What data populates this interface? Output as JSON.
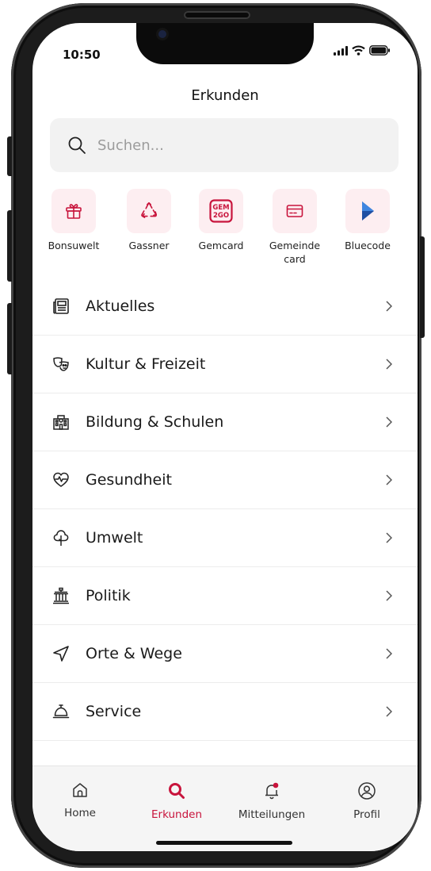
{
  "status_bar": {
    "time": "10:50"
  },
  "header": {
    "title": "Erkunden"
  },
  "search": {
    "placeholder": "Suchen..."
  },
  "quick_actions": [
    {
      "label": "Bonsuwelt",
      "icon": "gift-icon"
    },
    {
      "label": "Gassner",
      "icon": "recycle-icon"
    },
    {
      "label": "Gemcard",
      "icon": "gem2go-logo-icon",
      "logo_text": "GEM 2GO"
    },
    {
      "label": "Gemeinde card",
      "icon": "credit-card-icon"
    },
    {
      "label": "Bluecode",
      "icon": "bluecode-logo-icon"
    }
  ],
  "menu": [
    {
      "label": "Aktuelles",
      "icon": "newspaper-icon"
    },
    {
      "label": "Kultur & Freizeit",
      "icon": "theater-masks-icon"
    },
    {
      "label": "Bildung & Schulen",
      "icon": "school-building-icon"
    },
    {
      "label": "Gesundheit",
      "icon": "heart-pulse-icon"
    },
    {
      "label": "Umwelt",
      "icon": "tree-icon"
    },
    {
      "label": "Politik",
      "icon": "government-building-icon"
    },
    {
      "label": "Orte & Wege",
      "icon": "navigation-arrow-icon"
    },
    {
      "label": "Service",
      "icon": "service-bell-icon"
    }
  ],
  "tabbar": {
    "home": "Home",
    "explore": "Erkunden",
    "notifications": "Mitteilungen",
    "profile": "Profil"
  },
  "colors": {
    "accent": "#c8143c",
    "tile_background": "#fdeef1",
    "bluecode": "#1f4fa3"
  }
}
